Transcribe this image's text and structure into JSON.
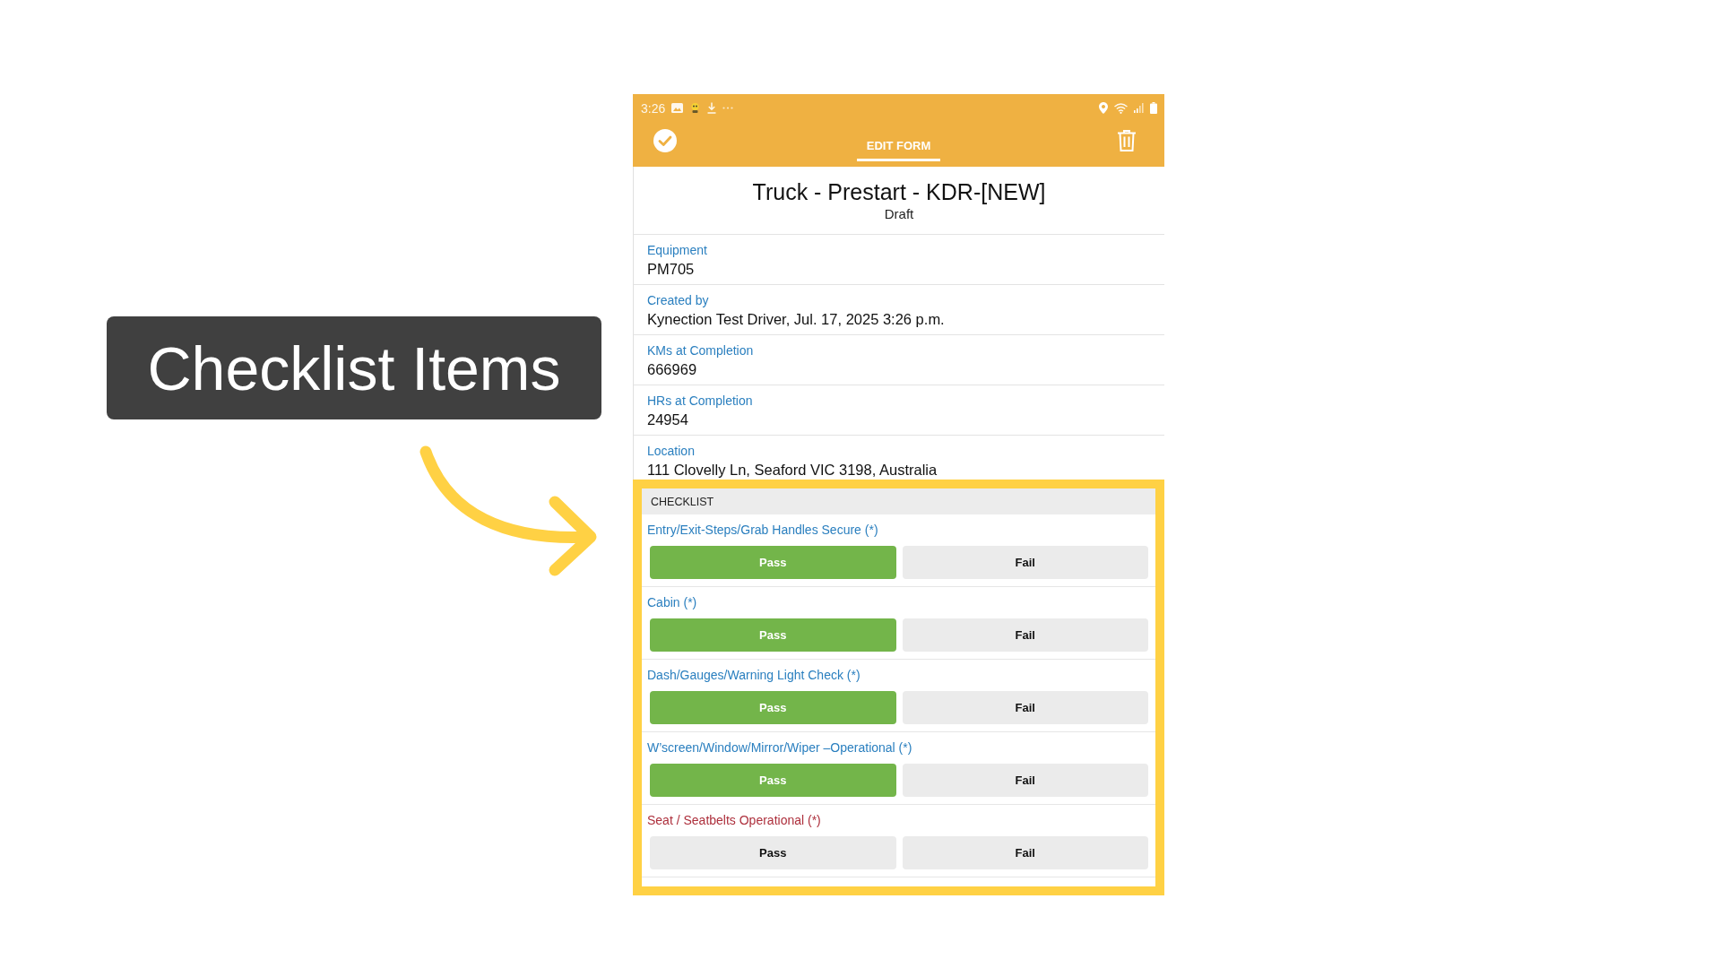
{
  "callout": {
    "text": "Checklist Items"
  },
  "status_bar": {
    "time": "3:26"
  },
  "app_bar": {
    "tabs": [
      {
        "label": "EDIT FORM",
        "selected": true
      }
    ]
  },
  "form": {
    "title": "Truck - Prestart - KDR-[NEW]",
    "status": "Draft",
    "fields": [
      {
        "label": "Equipment",
        "value": "PM705"
      },
      {
        "label": "Created by",
        "value": "Kynection Test Driver, Jul. 17, 2025 3:26 p.m."
      },
      {
        "label": "KMs at Completion",
        "value": "666969"
      },
      {
        "label": "HRs at Completion",
        "value": "24954"
      },
      {
        "label": "Location",
        "value": "111 Clovelly Ln, Seaford VIC 3198, Australia"
      }
    ]
  },
  "checklist": {
    "heading": "CHECKLIST",
    "highlighted": true,
    "items": [
      {
        "label": "Entry/Exit-Steps/Grab Handles Secure (*)",
        "invalid": false,
        "options": [
          {
            "kind": "pass",
            "label": "Pass",
            "selected": true
          },
          {
            "kind": "fail",
            "label": "Fail",
            "selected": false
          }
        ]
      },
      {
        "label": "Cabin (*)",
        "invalid": false,
        "options": [
          {
            "kind": "pass",
            "label": "Pass",
            "selected": true
          },
          {
            "kind": "fail",
            "label": "Fail",
            "selected": false
          }
        ]
      },
      {
        "label": "Dash/Gauges/Warning Light Check (*)",
        "invalid": false,
        "options": [
          {
            "kind": "pass",
            "label": "Pass",
            "selected": true
          },
          {
            "kind": "fail",
            "label": "Fail",
            "selected": false
          }
        ]
      },
      {
        "label": "W’screen/Window/Mirror/Wiper –Operational (*)",
        "invalid": false,
        "options": [
          {
            "kind": "pass",
            "label": "Pass",
            "selected": true
          },
          {
            "kind": "fail",
            "label": "Fail",
            "selected": false
          }
        ]
      },
      {
        "label": "Seat / Seatbelts Operational (*)",
        "invalid": true,
        "options": [
          {
            "kind": "pass",
            "label": "Pass",
            "selected": false
          },
          {
            "kind": "fail",
            "label": "Fail",
            "selected": false
          }
        ]
      }
    ]
  }
}
